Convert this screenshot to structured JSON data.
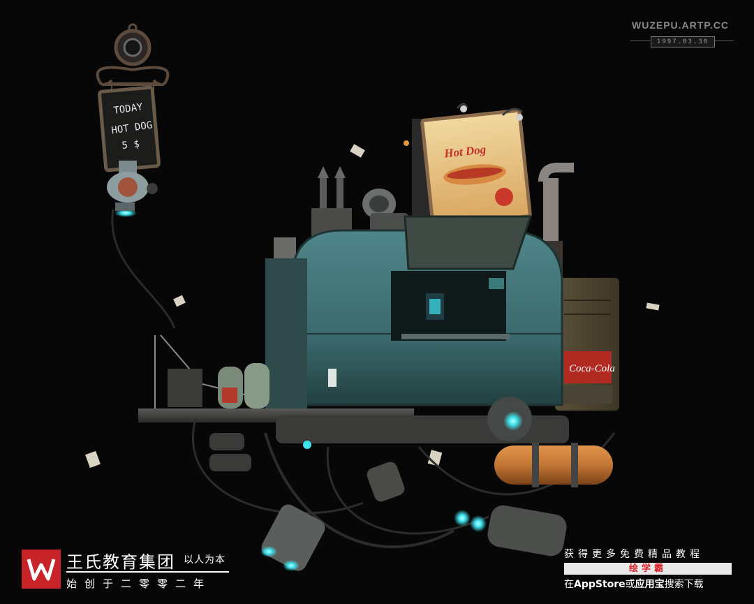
{
  "watermark": {
    "url": "WUZEPU.ARTP.CC",
    "date": "1997.03.30"
  },
  "sign": {
    "line1": "TODAY",
    "line2": "HOT DOG",
    "line3": "5 $"
  },
  "billboard": {
    "title": "Hot Dog"
  },
  "cooler_logo": "Coca-Cola",
  "brand": {
    "name": "王氏教育集团",
    "slogan": "以人为本",
    "subtitle": "始创于二零零二年"
  },
  "promo": {
    "line1": "获得更多免费精品教程",
    "app_name": "绘学霸",
    "line3_pre": "在",
    "line3_store": "AppStore",
    "line3_mid": "或",
    "line3_app": "应用宝",
    "line3_post": "搜索下载"
  },
  "colors": {
    "background": "#070707",
    "truck_teal": "#3f6f73",
    "copper": "#c77a3a",
    "glow_cyan": "#3fe3f0",
    "brand_red": "#c9232a"
  }
}
